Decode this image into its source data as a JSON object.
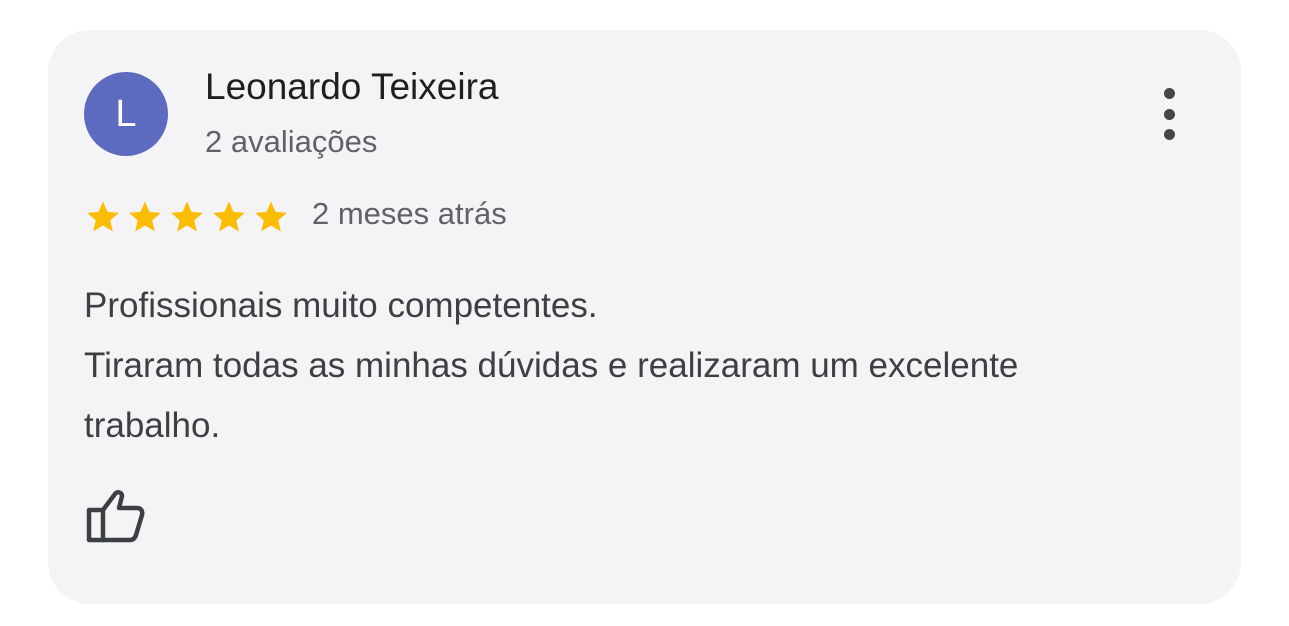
{
  "review": {
    "avatar_initial": "L",
    "avatar_color": "#5c6bc0",
    "author_name": "Leonardo Teixeira",
    "review_count": "2 avaliações",
    "rating": 5,
    "rating_max": 5,
    "star_color": "#fbbc04",
    "time_ago": "2 meses atrás",
    "text_lines": [
      "Profissionais muito competentes.",
      "Tiraram todas as minhas dúvidas e realizaram um excelente",
      "trabalho."
    ],
    "more_icon": "more-vert-icon",
    "like_icon": "thumb-up-outline-icon"
  }
}
